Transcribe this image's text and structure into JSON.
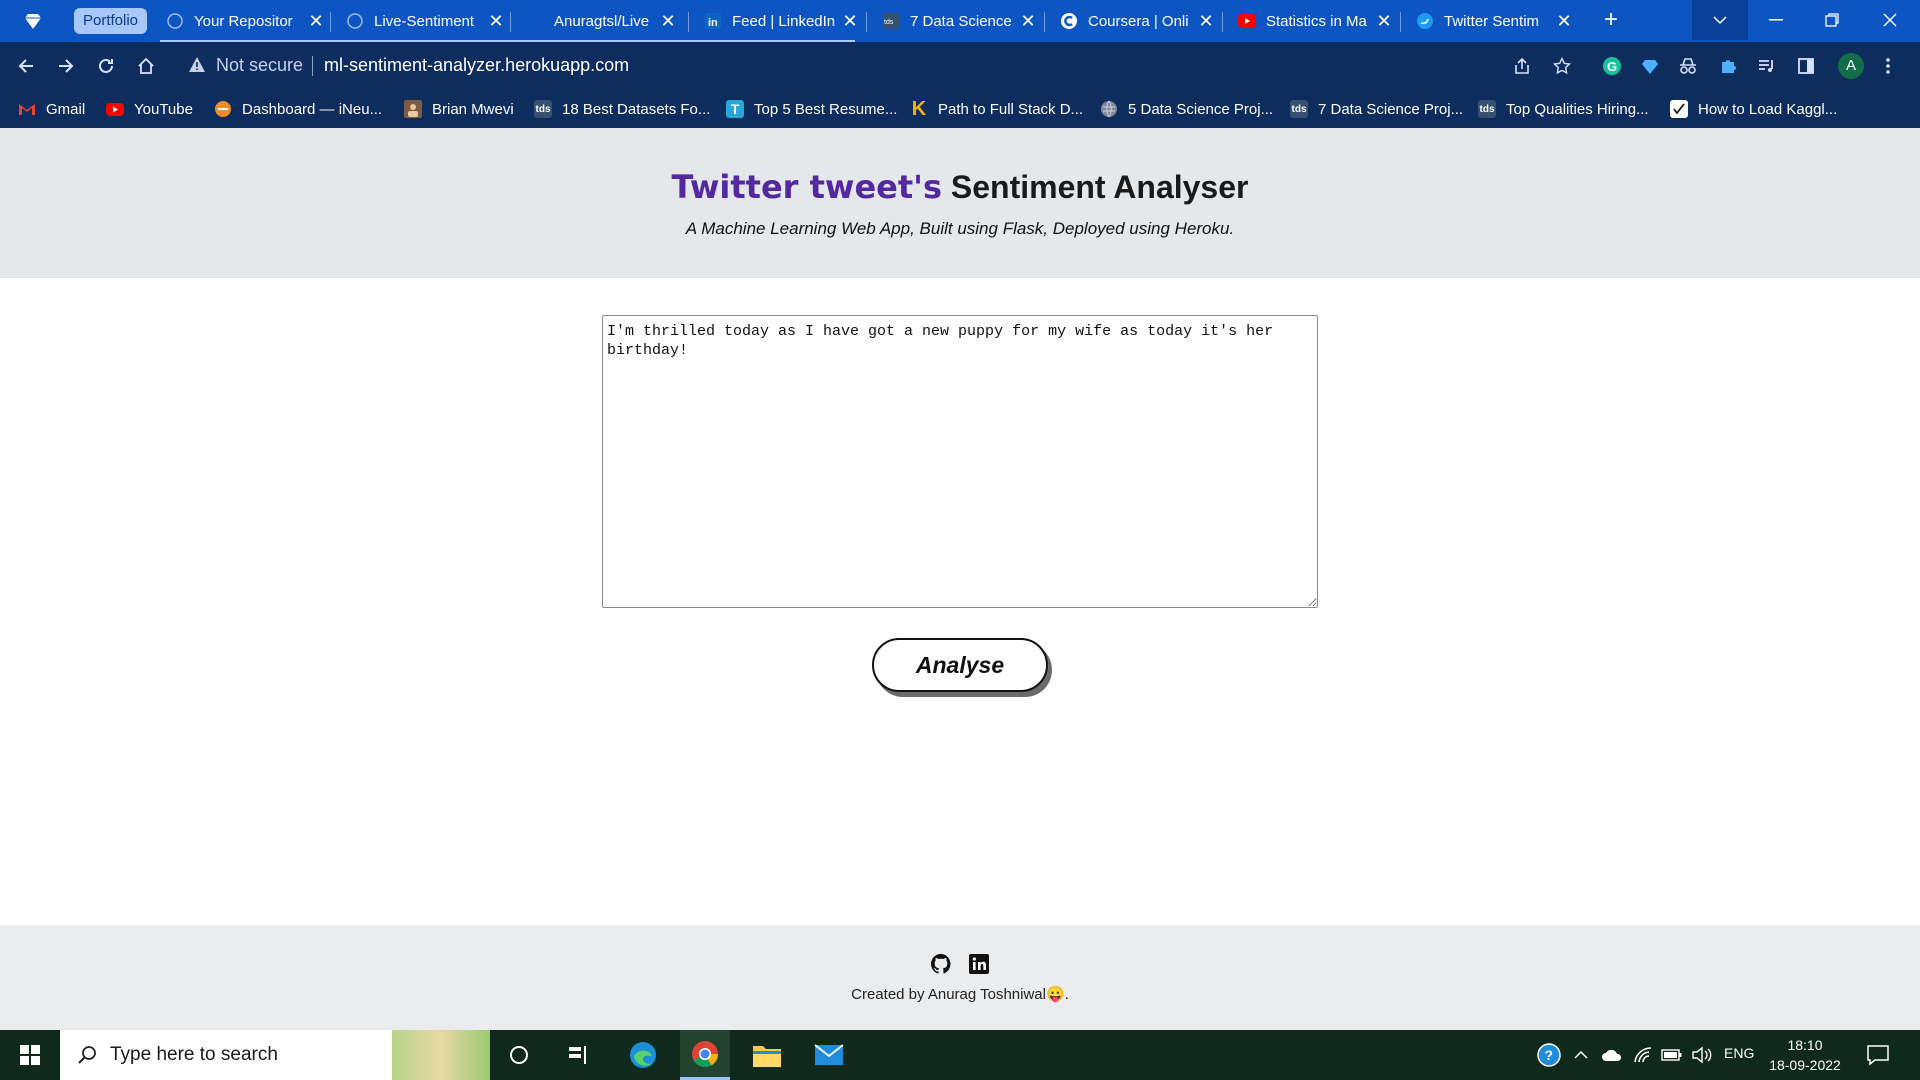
{
  "browser": {
    "tab_group_label": "Portfolio",
    "tabs": [
      {
        "title": "Your Repositor",
        "icon": "github-icon"
      },
      {
        "title": "Live-Sentiment",
        "icon": "github-icon"
      },
      {
        "title": "Anuragtsl/Live",
        "icon": "github-icon"
      },
      {
        "title": "Feed | LinkedIn",
        "icon": "linkedin-icon"
      },
      {
        "title": "7 Data Science",
        "icon": "tds-icon"
      },
      {
        "title": "Coursera | Onli",
        "icon": "coursera-icon"
      },
      {
        "title": "Statistics in Ma",
        "icon": "youtube-icon"
      },
      {
        "title": "Twitter Sentim",
        "icon": "twitter-icon"
      }
    ],
    "close_glyph": "✕",
    "new_tab_glyph": "+",
    "omnibox": {
      "security_text": "Not secure",
      "url": "ml-sentiment-analyzer.herokuapp.com"
    },
    "avatar_letter": "A",
    "bookmarks": [
      {
        "label": "Gmail",
        "icon": "gmail-icon"
      },
      {
        "label": "YouTube",
        "icon": "youtube-icon"
      },
      {
        "label": "Dashboard — iNeu...",
        "icon": "ineuron-icon"
      },
      {
        "label": "Brian Mwevi",
        "icon": "profile-icon"
      },
      {
        "label": "18 Best Datasets Fo...",
        "icon": "tds-icon"
      },
      {
        "label": "Top 5 Best Resume...",
        "icon": "t-icon"
      },
      {
        "label": "Path to Full Stack D...",
        "icon": "k-icon"
      },
      {
        "label": "5 Data Science Proj...",
        "icon": "globe-icon"
      },
      {
        "label": "7 Data Science Proj...",
        "icon": "tds-icon"
      },
      {
        "label": "Top Qualities Hiring...",
        "icon": "tds-icon"
      },
      {
        "label": "How to Load Kaggl...",
        "icon": "checkbox-icon"
      }
    ]
  },
  "page": {
    "title_accent": "Twitter tweet's",
    "title_rest": " Sentiment Analyser",
    "subtitle": "A Machine Learning Web App, Built using Flask, Deployed using Heroku.",
    "tweet_text": "I'm thrilled today as I have got a new puppy for my wife as today it's her birthday!",
    "analyse_label": "Analyse",
    "footer_text": "Created by Anurag Toshniwal😛."
  },
  "taskbar": {
    "search_placeholder": "Type here to search",
    "language": "ENG",
    "time": "18:10",
    "date": "18-09-2022"
  },
  "colors": {
    "tab_strip": "#0e55c4",
    "toolbar": "#0c2d5e",
    "title_accent": "#54289e",
    "hero_bg": "#e5e8ea",
    "taskbar": "#0f2a1c"
  }
}
